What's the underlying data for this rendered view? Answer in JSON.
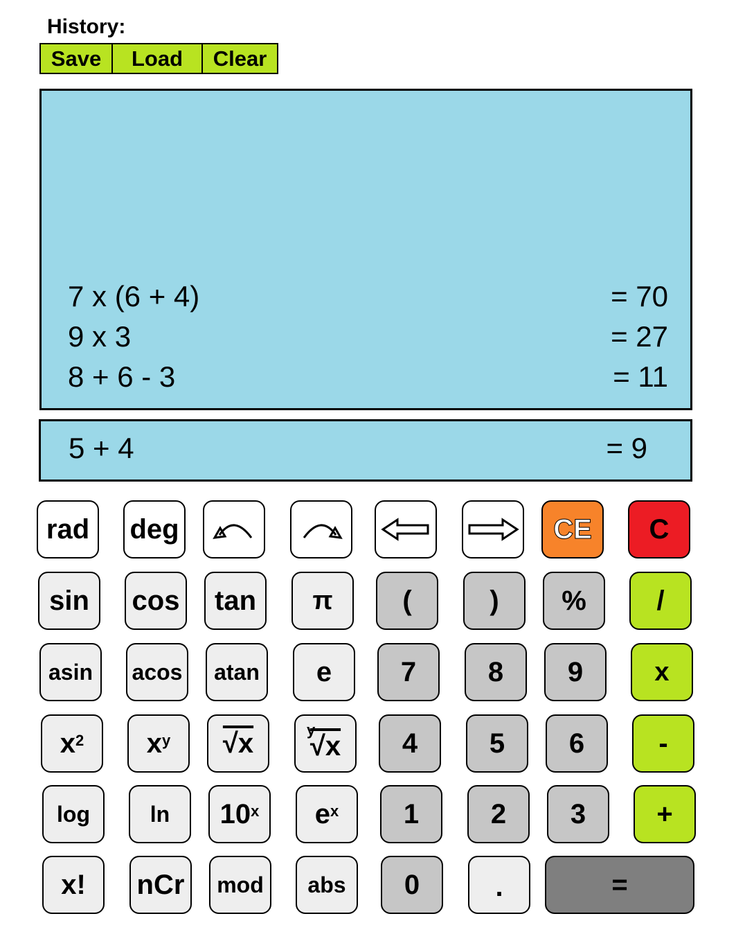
{
  "history": {
    "label": "History:",
    "save": "Save",
    "load": "Load",
    "clear": "Clear",
    "entries": [
      {
        "expression": "7 x (6 + 4)",
        "result": "= 70"
      },
      {
        "expression": "9 x 3",
        "result": "= 27"
      },
      {
        "expression": "8 + 6 - 3",
        "result": "= 11"
      }
    ]
  },
  "current": {
    "expression": "5 + 4",
    "result": "= 9"
  },
  "keys": {
    "rad": "rad",
    "deg": "deg",
    "undo_icon": "undo-arrow",
    "redo_icon": "redo-arrow",
    "left_icon": "left-arrow",
    "right_icon": "right-arrow",
    "ce": "CE",
    "c": "C",
    "sin": "sin",
    "cos": "cos",
    "tan": "tan",
    "pi": "π",
    "lparen": "(",
    "rparen": ")",
    "percent": "%",
    "divide": "/",
    "asin": "asin",
    "acos": "acos",
    "atan": "atan",
    "e": "e",
    "seven": "7",
    "eight": "8",
    "nine": "9",
    "multiply": "x",
    "x_base": "x",
    "sq_exp": "2",
    "pow_base": "x",
    "pow_exp": "y",
    "sqrt": "√x",
    "root_idx": "y",
    "root": "√x",
    "four": "4",
    "five": "5",
    "six": "6",
    "minus": "-",
    "log": "log",
    "ln": "ln",
    "ten_base": "10",
    "ten_exp": "x",
    "e_base": "e",
    "e_exp": "x",
    "one": "1",
    "two": "2",
    "three": "3",
    "plus": "+",
    "fact": "x!",
    "ncr": "nCr",
    "mod": "mod",
    "abs": "abs",
    "zero": "0",
    "dot": ".",
    "equals": "="
  },
  "colors": {
    "display_bg": "#9bd8e8",
    "operator_green": "#b8e321",
    "ce_orange": "#f7832a",
    "clear_red": "#ec1c24",
    "digit_gray": "#c6c6c6",
    "function_gray": "#eeeeee",
    "equals_gray": "#7f7f7f"
  }
}
